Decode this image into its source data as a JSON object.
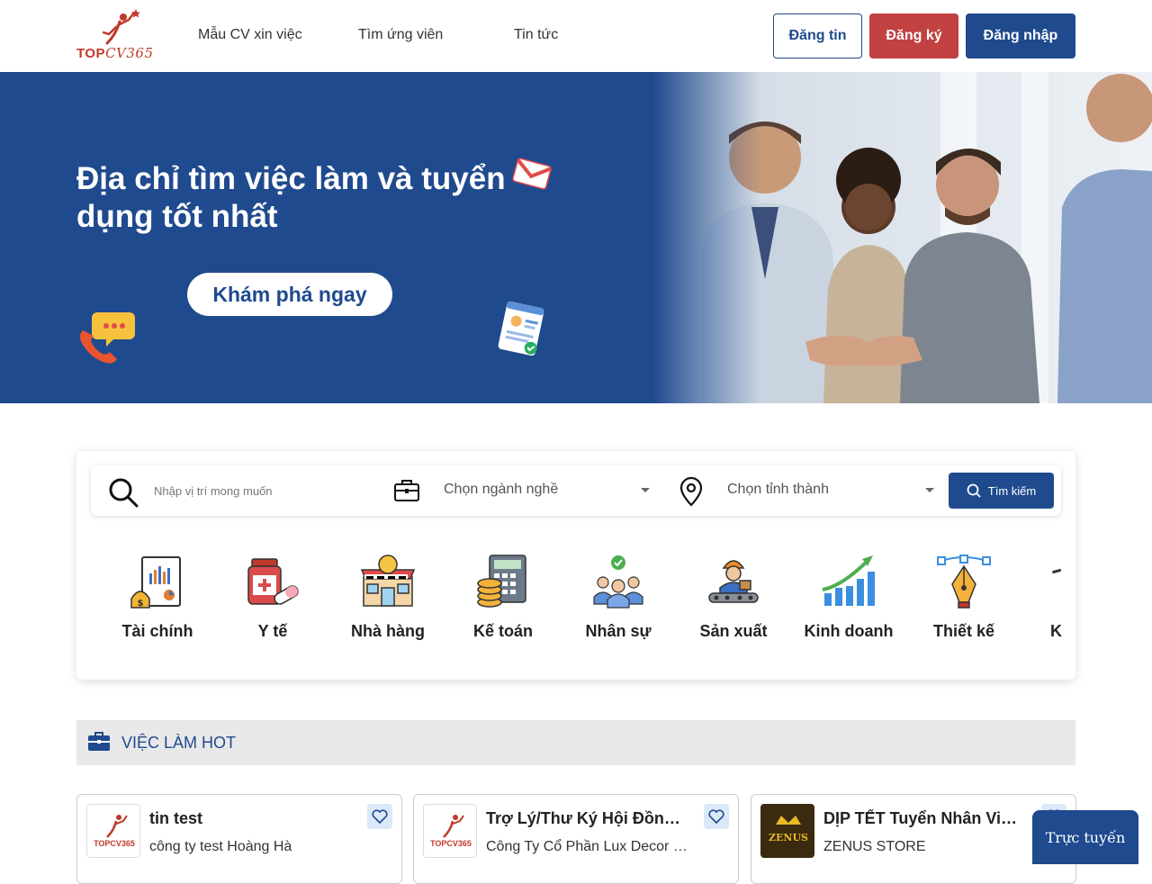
{
  "header": {
    "logo": {
      "top": "TOP",
      "cv": "CV365"
    },
    "nav": [
      {
        "label": "Mẫu CV xin việc"
      },
      {
        "label": "Tìm ứng viên"
      },
      {
        "label": "Tin tức"
      }
    ],
    "buttons": {
      "post": "Đăng tin",
      "register": "Đăng ký",
      "login": "Đăng nhập"
    }
  },
  "hero": {
    "title": "Địa chỉ tìm việc làm và tuyển dụng tốt nhất",
    "cta": "Khám phá ngay"
  },
  "search": {
    "placeholder": "Nhập vị trí mong muốn",
    "industry": "Chọn ngành nghề",
    "location": "Chọn tỉnh thành",
    "button": "Tìm kiếm"
  },
  "categories": [
    {
      "label": "Tài chính",
      "icon": "finance-icon"
    },
    {
      "label": "Y tế",
      "icon": "medicine-icon"
    },
    {
      "label": "Nhà hàng",
      "icon": "restaurant-icon"
    },
    {
      "label": "Kế toán",
      "icon": "calculator-icon"
    },
    {
      "label": "Nhân sự",
      "icon": "team-icon"
    },
    {
      "label": "Sản xuất",
      "icon": "worker-icon"
    },
    {
      "label": "Kinh doanh",
      "icon": "growth-chart-icon"
    },
    {
      "label": "Thiết kế",
      "icon": "pen-tool-icon"
    },
    {
      "label": "K",
      "icon": "category-icon"
    }
  ],
  "hot_jobs": {
    "title": "VIỆC LÀM HOT",
    "jobs": [
      {
        "title": "tin test",
        "company": "công ty test Hoàng Hà",
        "logo": "TOPCV365"
      },
      {
        "title": "Trợ Lý/Thư Ký Hội Đồng Quản Trị",
        "company": "Công Ty Cổ Phần Lux Decor Việt Nam",
        "logo": "TOPCV365"
      },
      {
        "title": "DỊP TẾT Tuyển Nhân Viên Bán Hàng",
        "company": "ZENUS STORE",
        "logo": "ZENUS"
      }
    ]
  },
  "chat": {
    "label": "Trực tuyến"
  },
  "colors": {
    "primary": "#1f4a8e",
    "danger": "#c24141",
    "hero_bg": "#1f4a8e"
  }
}
